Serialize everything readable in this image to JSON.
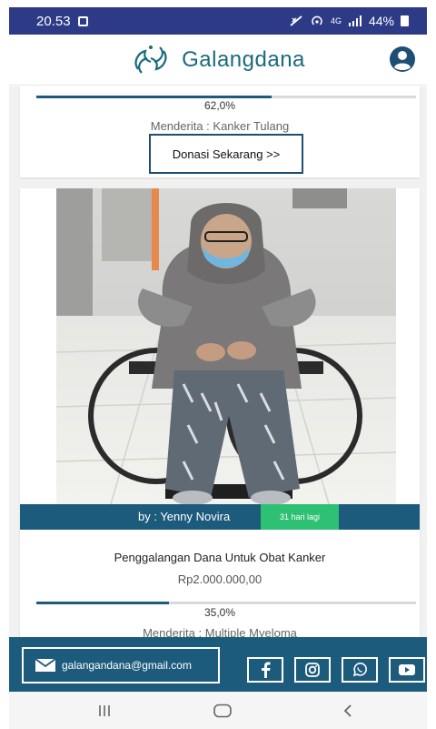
{
  "status_bar": {
    "time": "20.53",
    "signal_text": "4G",
    "battery": "44%"
  },
  "header": {
    "brand_name": "Galangdana",
    "logo_icon": "hands-logo-icon",
    "account_icon": "user-account-icon"
  },
  "card_prev": {
    "progress_text": "62,0%",
    "progress_fraction": 0.62,
    "sufferer": "Menderita : Kanker Tulang",
    "donate_label": "Donasi Sekarang >>"
  },
  "card_main": {
    "by": "by : Yenny Novira",
    "days_left": "31 hari lagi",
    "title": "Penggalangan Dana Untuk Obat Kanker",
    "amount": "Rp2.000.000,00",
    "progress_text": "35,0%",
    "progress_fraction": 0.35,
    "sufferer": "Menderita : Multiple Myeloma"
  },
  "footer": {
    "email": "galangandana@gmail.com",
    "social_icons": [
      "facebook-icon",
      "instagram-icon",
      "whatsapp-icon",
      "youtube-icon"
    ]
  },
  "colors": {
    "primary": "#1d5b7c",
    "badge_green": "#2ec173",
    "status_bar": "#2d3a86"
  }
}
